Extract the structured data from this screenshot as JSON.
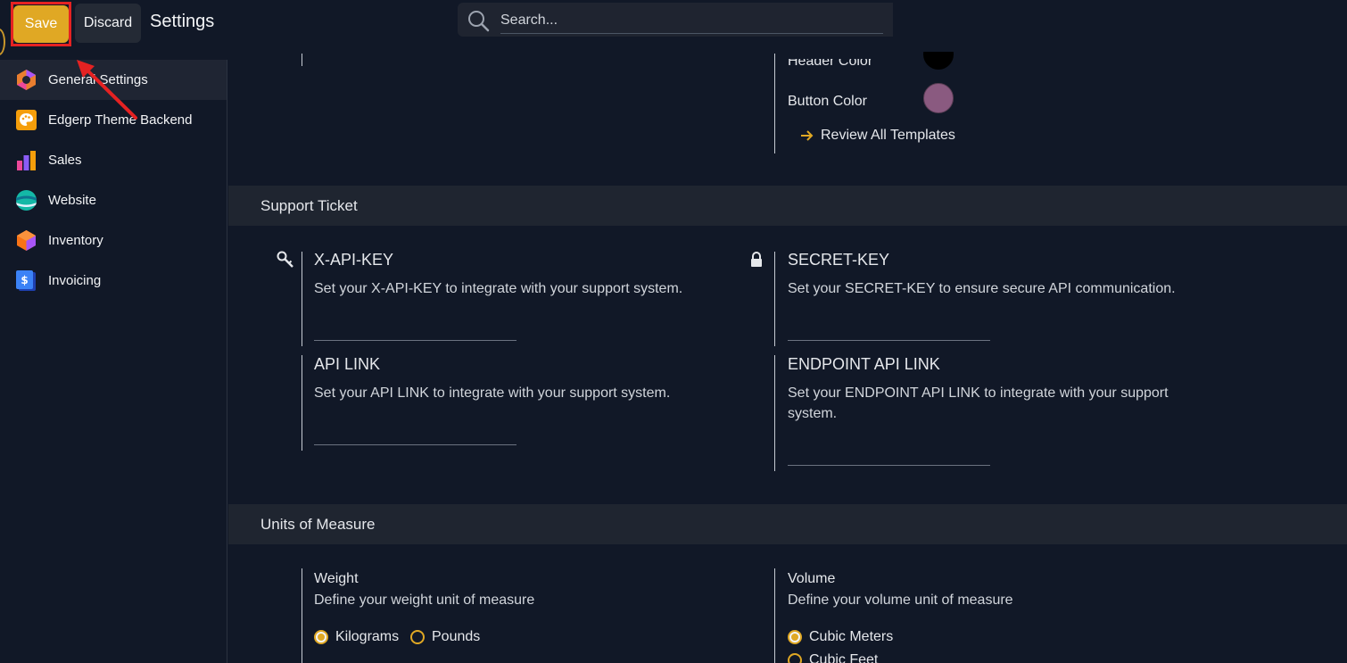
{
  "topbar": {
    "save_label": "Save",
    "discard_label": "Discard",
    "page_title": "Settings",
    "search_placeholder": "Search..."
  },
  "sidebar": {
    "items": [
      {
        "label": "General Settings",
        "icon": "general-settings-icon",
        "active": true
      },
      {
        "label": "Edgerp Theme Backend",
        "icon": "palette-icon",
        "active": false
      },
      {
        "label": "Sales",
        "icon": "sales-chart-icon",
        "active": false
      },
      {
        "label": "Website",
        "icon": "website-globe-icon",
        "active": false
      },
      {
        "label": "Inventory",
        "icon": "inventory-box-icon",
        "active": false
      },
      {
        "label": "Invoicing",
        "icon": "invoicing-dollar-icon",
        "active": false
      }
    ]
  },
  "theme": {
    "header_color_label": "Header Color",
    "header_color_value": "#000000",
    "button_color_label": "Button Color",
    "button_color_value": "#8a5a80",
    "review_templates_label": "Review All Templates"
  },
  "support_ticket": {
    "section_title": "Support Ticket",
    "fields": [
      {
        "title": "X-API-KEY",
        "desc": "Set your X-API-KEY to integrate with your support system.",
        "icon": "key-icon"
      },
      {
        "title": "SECRET-KEY",
        "desc": "Set your SECRET-KEY to ensure secure API communication.",
        "icon": "lock-icon"
      },
      {
        "title": "API LINK",
        "desc": "Set your API LINK to integrate with your support system."
      },
      {
        "title": "ENDPOINT API LINK",
        "desc_line1": "Set your ENDPOINT API LINK to integrate with your support",
        "desc_line2": "system."
      }
    ]
  },
  "units": {
    "section_title": "Units of Measure",
    "weight": {
      "title": "Weight",
      "desc": "Define your weight unit of measure",
      "options": [
        {
          "label": "Kilograms",
          "checked": true
        },
        {
          "label": "Pounds",
          "checked": false
        }
      ]
    },
    "volume": {
      "title": "Volume",
      "desc": "Define your volume unit of measure",
      "options": [
        {
          "label": "Cubic Meters",
          "checked": true
        },
        {
          "label": "Cubic Feet",
          "checked": false
        }
      ]
    }
  },
  "colors": {
    "accent": "#e0a824",
    "background": "#111827",
    "section_bar": "#1f2530",
    "highlight": "#e52222"
  }
}
